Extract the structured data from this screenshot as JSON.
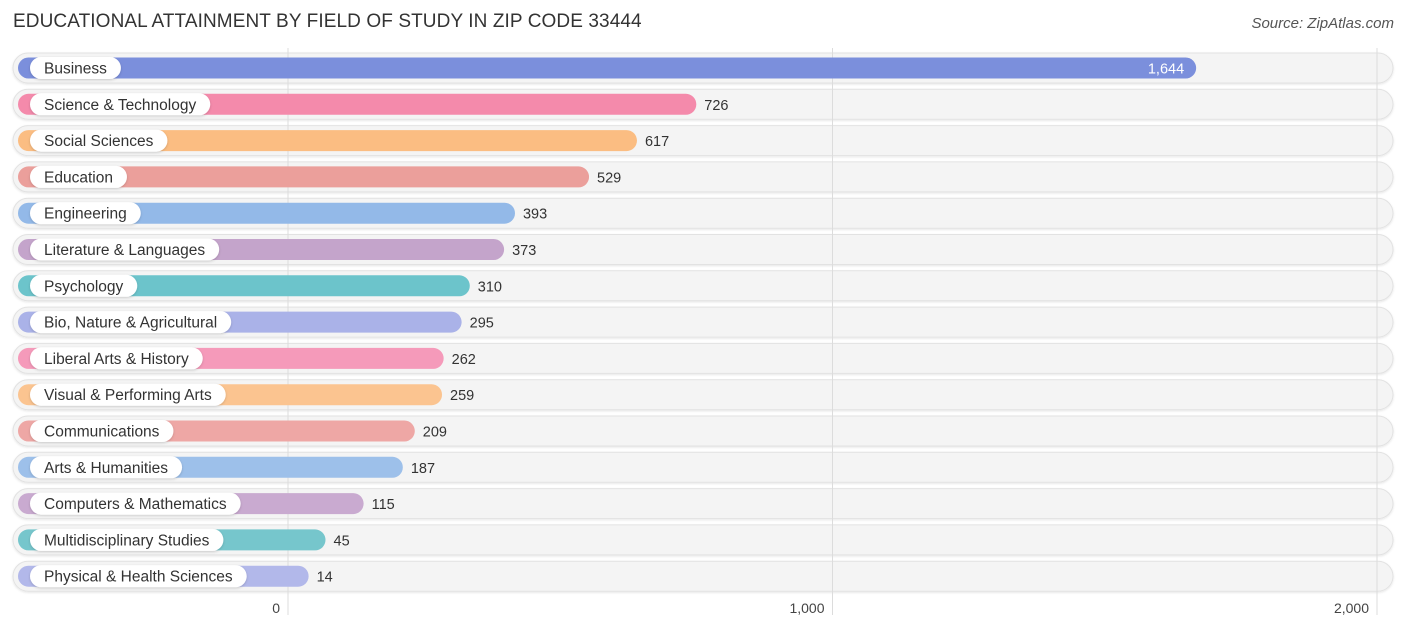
{
  "header": {
    "title": "EDUCATIONAL ATTAINMENT BY FIELD OF STUDY IN ZIP CODE 33444",
    "source": "Source: ZipAtlas.com"
  },
  "chart_data": {
    "type": "bar",
    "orientation": "horizontal",
    "title": "EDUCATIONAL ATTAINMENT BY FIELD OF STUDY IN ZIP CODE 33444",
    "source": "Source: ZipAtlas.com",
    "xlabel": "",
    "ylabel": "",
    "xlim": [
      0,
      2000
    ],
    "grid": true,
    "legend": "none",
    "x_ticks": [
      0,
      1000,
      2000
    ],
    "x_tick_labels": [
      "0",
      "1,000",
      "2,000"
    ],
    "categories": [
      "Business",
      "Science & Technology",
      "Social Sciences",
      "Education",
      "Engineering",
      "Literature & Languages",
      "Psychology",
      "Bio, Nature & Agricultural",
      "Liberal Arts & History",
      "Visual & Performing Arts",
      "Communications",
      "Arts & Humanities",
      "Computers & Mathematics",
      "Multidisciplinary Studies",
      "Physical & Health Sciences"
    ],
    "values": [
      1644,
      726,
      617,
      529,
      393,
      373,
      310,
      295,
      262,
      259,
      209,
      187,
      115,
      45,
      14
    ],
    "value_labels": [
      "1,644",
      "726",
      "617",
      "529",
      "393",
      "373",
      "310",
      "295",
      "262",
      "259",
      "209",
      "187",
      "115",
      "45",
      "14"
    ],
    "colors": [
      "#7b8fdc",
      "#f48aab",
      "#fbbd82",
      "#eb9f9b",
      "#93b9e8",
      "#c4a4cb",
      "#6cc4cb",
      "#aab2e8",
      "#f59aba",
      "#fbc490",
      "#eea7a5",
      "#9dc0ea",
      "#c9aad0",
      "#76c6cc",
      "#b2b8ea"
    ]
  }
}
